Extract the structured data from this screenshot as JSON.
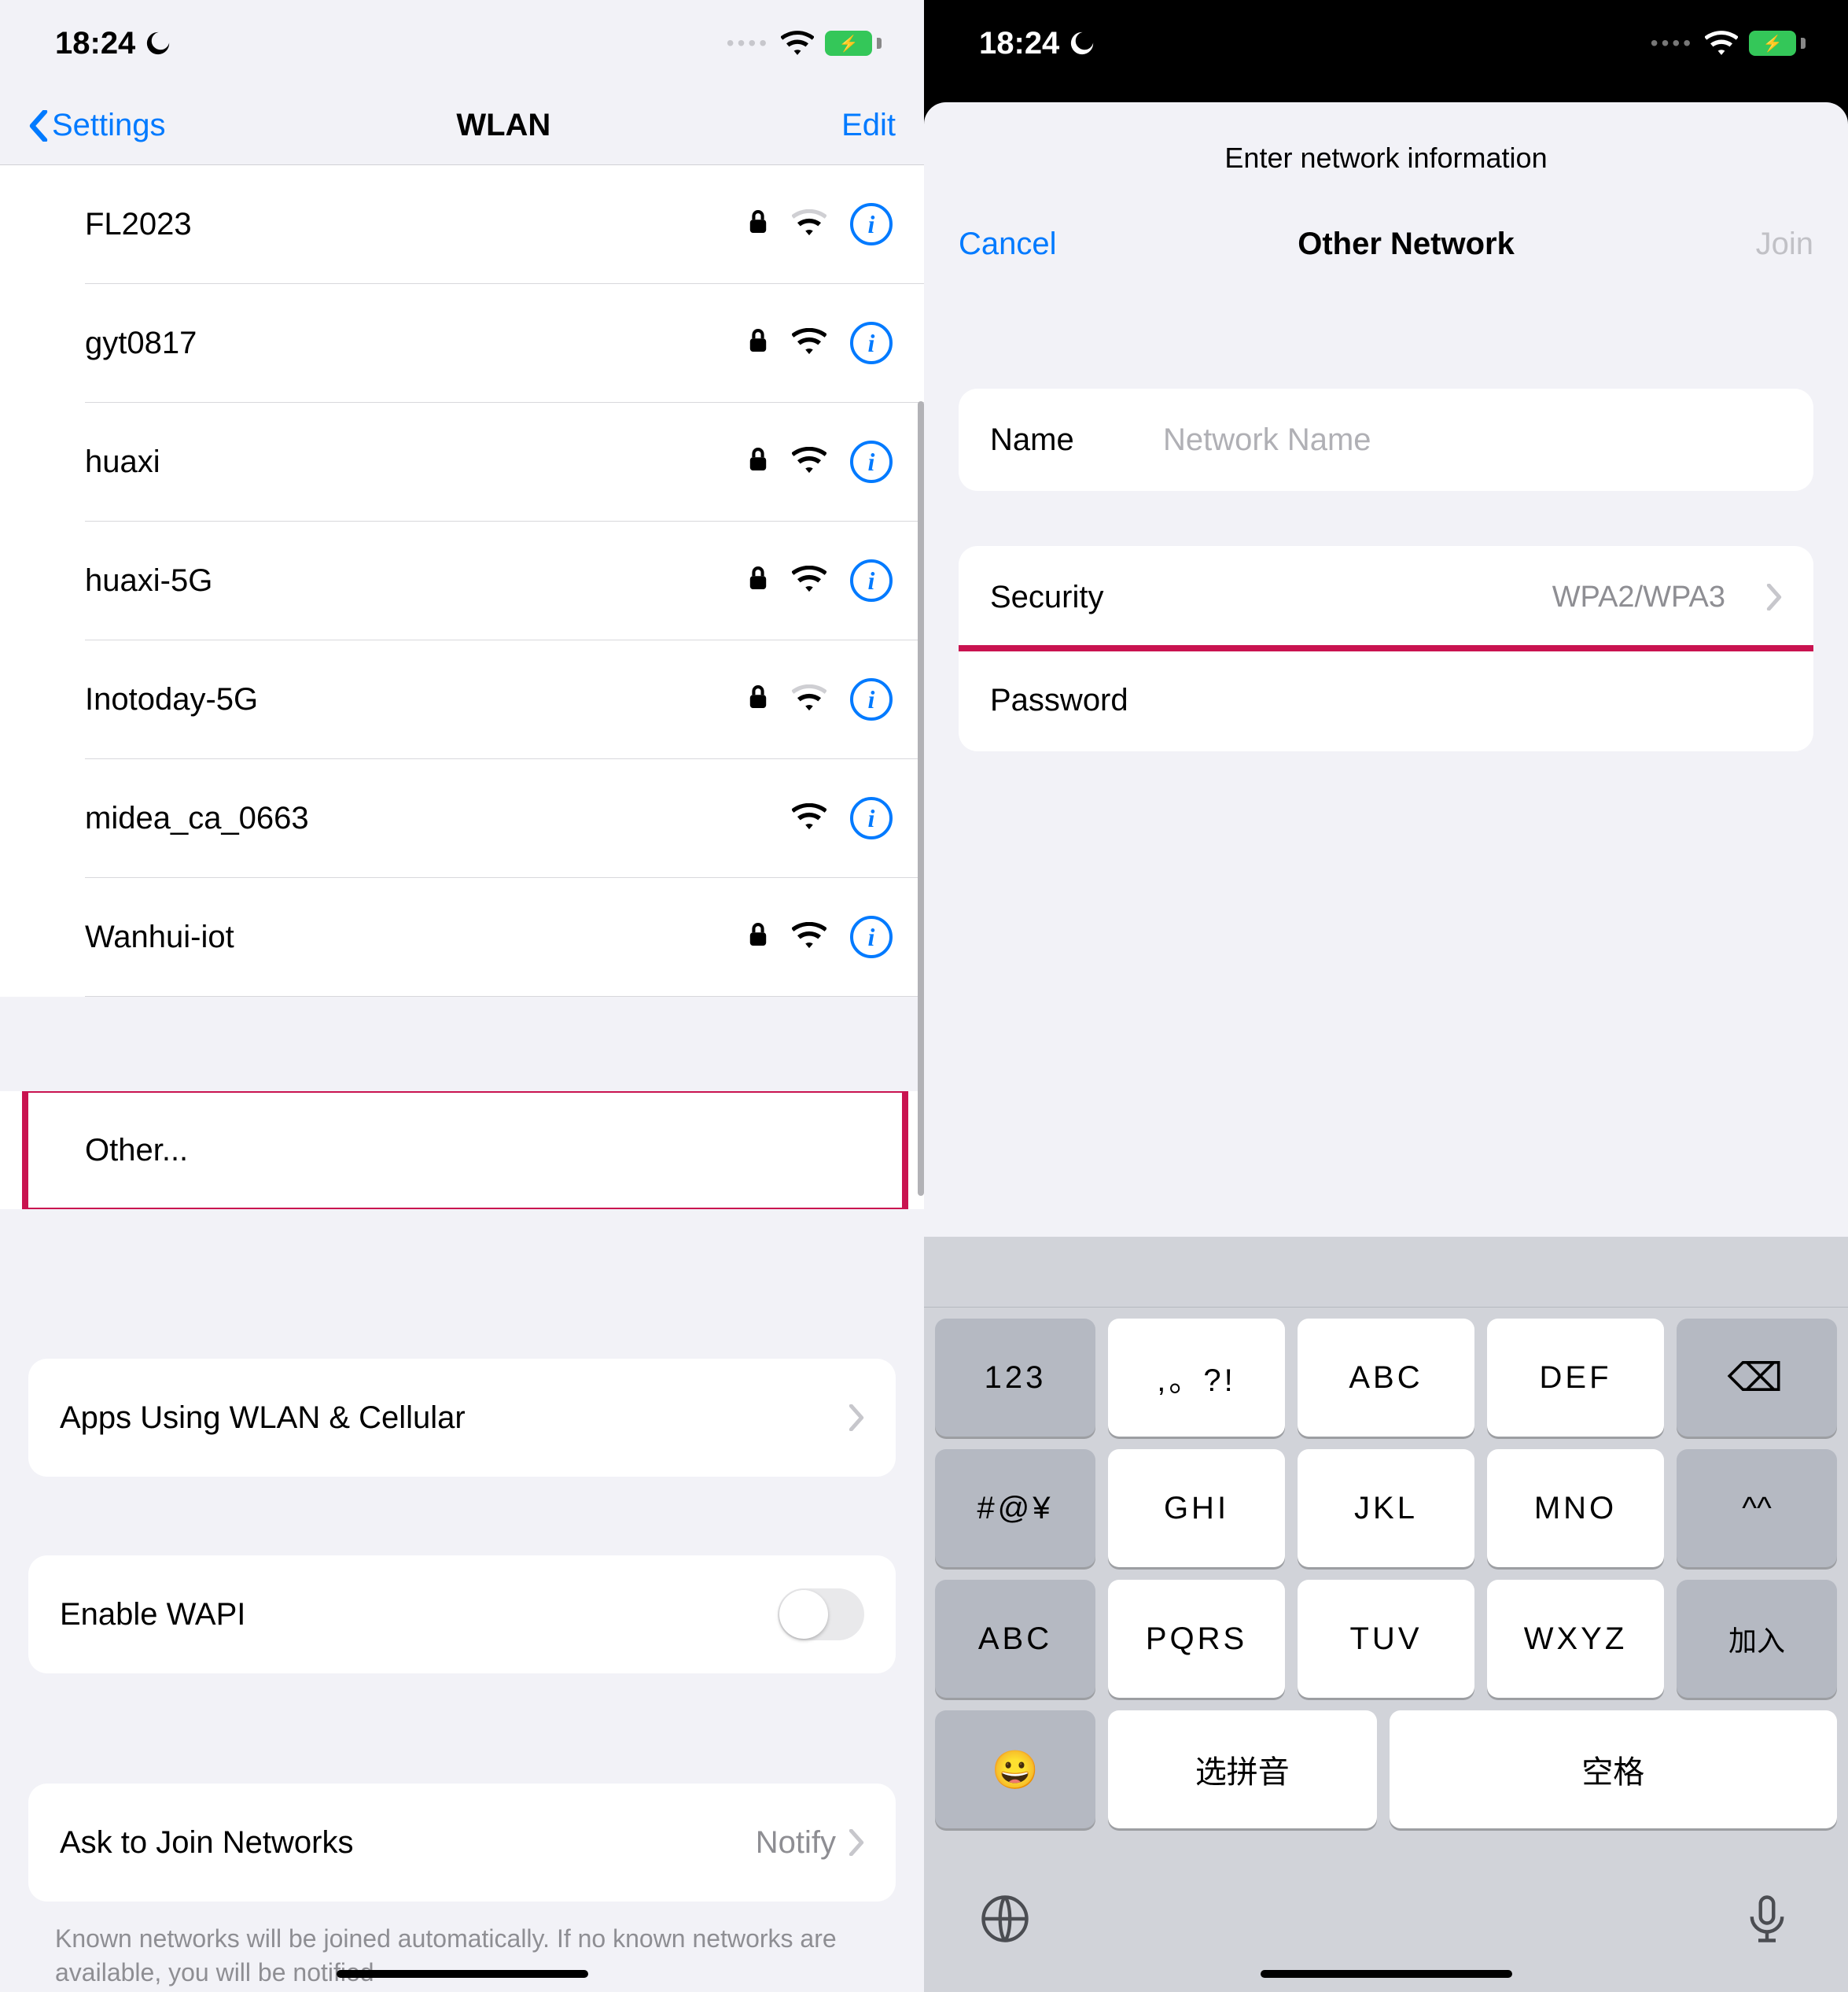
{
  "status": {
    "time": "18:24"
  },
  "left": {
    "nav": {
      "back": "Settings",
      "title": "WLAN",
      "edit": "Edit"
    },
    "networks": [
      {
        "name": "FL2023",
        "locked": true,
        "strength": "weak"
      },
      {
        "name": "gyt0817",
        "locked": true,
        "strength": "strong"
      },
      {
        "name": "huaxi",
        "locked": true,
        "strength": "strong"
      },
      {
        "name": "huaxi-5G",
        "locked": true,
        "strength": "strong"
      },
      {
        "name": "Inotoday-5G",
        "locked": true,
        "strength": "weak"
      },
      {
        "name": "midea_ca_0663",
        "locked": false,
        "strength": "strong"
      },
      {
        "name": "Wanhui-iot",
        "locked": true,
        "strength": "strong"
      }
    ],
    "other": "Other...",
    "apps_row": "Apps Using WLAN & Cellular",
    "wapi_row": "Enable WAPI",
    "ask_row": {
      "label": "Ask to Join Networks",
      "value": "Notify"
    },
    "footer": "Known networks will be joined automatically. If no known networks are available, you will be notified"
  },
  "right": {
    "modal_title": "Enter network information",
    "cancel": "Cancel",
    "sheet_title": "Other Network",
    "join": "Join",
    "name_label": "Name",
    "name_placeholder": "Network Name",
    "security_label": "Security",
    "security_value": "WPA2/WPA3",
    "password_label": "Password",
    "keyboard": {
      "row1": [
        "123",
        ",。?!",
        "ABC",
        "DEF"
      ],
      "backspace": "⌫",
      "row2": [
        "#@¥",
        "GHI",
        "JKL",
        "MNO"
      ],
      "face": "^^",
      "row3": [
        "ABC",
        "PQRS",
        "TUV",
        "WXYZ"
      ],
      "enter": "加入",
      "emoji": "😀",
      "select": "选拼音",
      "space": "空格"
    }
  }
}
